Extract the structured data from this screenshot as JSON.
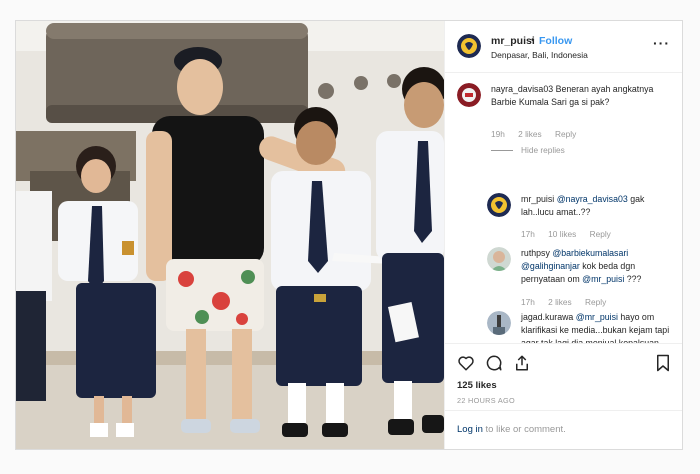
{
  "header": {
    "username": "mr_puisi",
    "dot": "•",
    "follow_label": "Follow",
    "location": "Denpasar, Bali, Indonesia",
    "more_icon": "more-horizontal-icon"
  },
  "comments": [
    {
      "user": "nayra_davisa03",
      "text": "Beneran ayah angkatnya Barbie Kumala Sari ga si pak?",
      "time": "19h",
      "likes": "2 likes",
      "reply": "Reply",
      "hide_replies": "Hide replies"
    },
    {
      "user": "mr_puisi",
      "mention": "@nayra_davisa03",
      "text": "gak lah..lucu amat..??",
      "time": "17h",
      "likes": "10 likes",
      "reply": "Reply"
    },
    {
      "user": "ruthpsy",
      "mention1": "@barbiekumalasari",
      "mention2": "@galihginanjar",
      "text1": "kok beda dgn pernyataan om",
      "mention3": "@mr_puisi",
      "text2": "???",
      "time": "17h",
      "likes": "2 likes",
      "reply": "Reply"
    },
    {
      "user": "jagad.kurawa",
      "mention": "@mr_puisi",
      "text": "hayo om klarifikasi ke media...bukan kejam tapi agar tak lagi dia menjual kepalsuan...",
      "time": "",
      "likes": "",
      "reply": ""
    }
  ],
  "actions": {
    "like_icon": "heart-icon",
    "comment_icon": "comment-icon",
    "share_icon": "share-icon",
    "save_icon": "bookmark-icon",
    "likes": "125 likes",
    "time": "22 HOURS AGO"
  },
  "login": {
    "link": "Log in",
    "text": "to like or comment."
  }
}
